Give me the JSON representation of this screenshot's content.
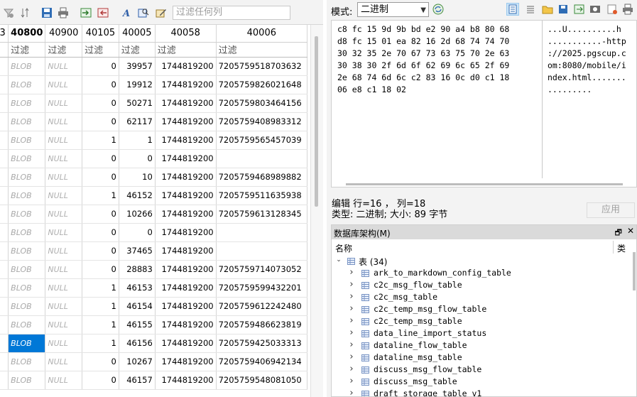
{
  "left_toolbar": {
    "filter_placeholder": "过滤任何列",
    "icons": [
      "filter-clear-icon",
      "sort-icon",
      "save-icon",
      "print-icon",
      "export-icon",
      "import-icon",
      "text-style-icon",
      "find-icon",
      "edit-icon"
    ]
  },
  "grid": {
    "headers": [
      "3",
      "40800",
      "40900",
      "40105",
      "40005",
      "40058",
      "40006"
    ],
    "filter_label": "过滤",
    "rows": [
      {
        "blob": "BLOB",
        "null": "NULL",
        "c3": "0",
        "c4": "39957",
        "c5": "1744819200",
        "c6": "7205759518703632"
      },
      {
        "blob": "BLOB",
        "null": "NULL",
        "c3": "0",
        "c4": "19912",
        "c5": "1744819200",
        "c6": "7205759826021648"
      },
      {
        "blob": "BLOB",
        "null": "NULL",
        "c3": "0",
        "c4": "50271",
        "c5": "1744819200",
        "c6": "7205759803464156"
      },
      {
        "blob": "BLOB",
        "null": "NULL",
        "c3": "0",
        "c4": "62117",
        "c5": "1744819200",
        "c6": "7205759408983312"
      },
      {
        "blob": "BLOB",
        "null": "NULL",
        "c3": "1",
        "c4": "1",
        "c5": "1744819200",
        "c6": "7205759565457039"
      },
      {
        "blob": "BLOB",
        "null": "NULL",
        "c3": "0",
        "c4": "0",
        "c5": "1744819200",
        "c6": ""
      },
      {
        "blob": "BLOB",
        "null": "NULL",
        "c3": "0",
        "c4": "10",
        "c5": "1744819200",
        "c6": "7205759468989882"
      },
      {
        "blob": "BLOB",
        "null": "NULL",
        "c3": "1",
        "c4": "46152",
        "c5": "1744819200",
        "c6": "7205759511635938"
      },
      {
        "blob": "BLOB",
        "null": "NULL",
        "c3": "0",
        "c4": "10266",
        "c5": "1744819200",
        "c6": "7205759613128345"
      },
      {
        "blob": "BLOB",
        "null": "NULL",
        "c3": "0",
        "c4": "0",
        "c5": "1744819200",
        "c6": ""
      },
      {
        "blob": "BLOB",
        "null": "NULL",
        "c3": "0",
        "c4": "37465",
        "c5": "1744819200",
        "c6": ""
      },
      {
        "blob": "BLOB",
        "null": "NULL",
        "c3": "0",
        "c4": "28883",
        "c5": "1744819200",
        "c6": "7205759714073052"
      },
      {
        "blob": "BLOB",
        "null": "NULL",
        "c3": "1",
        "c4": "46153",
        "c5": "1744819200",
        "c6": "7205759599432201"
      },
      {
        "blob": "BLOB",
        "null": "NULL",
        "c3": "1",
        "c4": "46154",
        "c5": "1744819200",
        "c6": "7205759612242480"
      },
      {
        "blob": "BLOB",
        "null": "NULL",
        "c3": "1",
        "c4": "46155",
        "c5": "1744819200",
        "c6": "7205759486623819"
      },
      {
        "blob": "BLOB",
        "null": "NULL",
        "c3": "1",
        "c4": "46156",
        "c5": "1744819200",
        "c6": "7205759425033313"
      },
      {
        "blob": "BLOB",
        "null": "NULL",
        "c3": "0",
        "c4": "10267",
        "c5": "1744819200",
        "c6": "7205759406942134"
      },
      {
        "blob": "BLOB",
        "null": "NULL",
        "c3": "0",
        "c4": "46157",
        "c5": "1744819200",
        "c6": "7205759548081050"
      }
    ],
    "selected_row": 15,
    "selection_color": "#0078d7"
  },
  "right_toolbar": {
    "mode_label": "模式:",
    "mode_value": "二进制",
    "icons": [
      "auto-switch-icon",
      "text-mode-icon",
      "list-icon",
      "open-file-icon",
      "save-file-icon",
      "export-icon",
      "image-icon",
      "clear-icon",
      "print-icon"
    ]
  },
  "hex_editor": {
    "hex_lines": [
      "c8 fc 15 9d 9b bd e2 90 a4 b8 80 68",
      "d8 fc 15 01 ea 82 16 2d 68 74 74 70",
      "30 32 35 2e 70 67 73 63 75 70 2e 63",
      "30 38 30 2f 6d 6f 62 69 6c 65 2f 69",
      "2e 68 74 6d 6c c2 83 16 0c d0 c1 18",
      "06 e8 c1 18 02"
    ],
    "ascii_lines": [
      "...U..........h",
      "...........-http",
      "://2025.pgscup.c",
      "om:8080/mobile/i",
      "ndex.html.......",
      "........."
    ]
  },
  "status": {
    "edit_line": "编辑  行=16 ， 列=18",
    "type_line": "类型: 二进制; 大小: 89 字节",
    "apply_label": "应用"
  },
  "schema": {
    "title": "数据库架构(M)",
    "float_label": "🗗",
    "close_label": "✕",
    "col_name": "名称",
    "col_type": "类",
    "root_label": "表 (34)",
    "tables": [
      "ark_to_markdown_config_table",
      "c2c_msg_flow_table",
      "c2c_msg_table",
      "c2c_temp_msg_flow_table",
      "c2c_temp_msg_table",
      "data_line_import_status",
      "dataline_flow_table",
      "dataline_msg_table",
      "discuss_msg_flow_table",
      "discuss_msg_table",
      "draft_storage_table_v1"
    ]
  }
}
